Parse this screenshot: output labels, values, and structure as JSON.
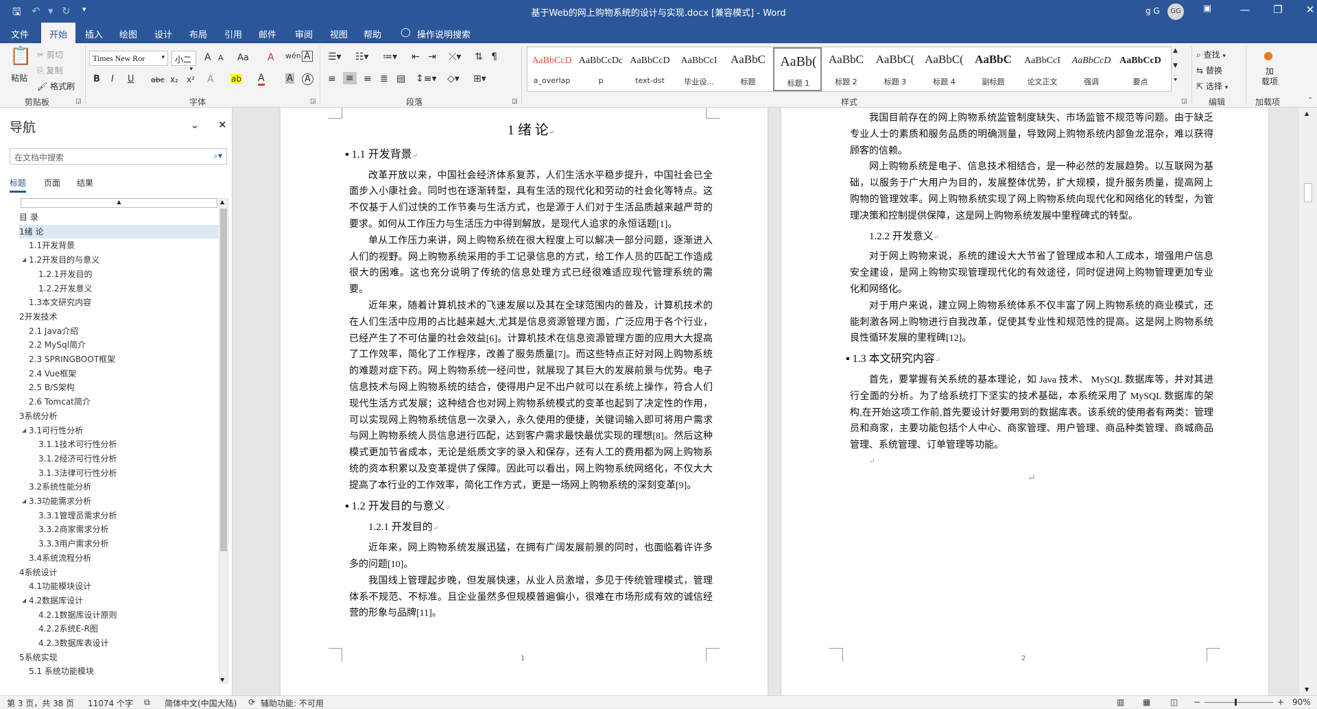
{
  "titlebar": {
    "save_icon": "save-icon",
    "undo_icon": "undo-icon",
    "redo_icon": "redo-icon",
    "customize_icon": "customize-icon",
    "title": "基于Web的网上购物系统的设计与实现.docx [兼容模式]  -  Word",
    "user": "g G",
    "avatar": "GG",
    "ribbon_display_icon": "ribbon-display-icon",
    "minimize": "—",
    "restore": "❐",
    "close": "✕"
  },
  "tabs": [
    "文件",
    "开始",
    "插入",
    "绘图",
    "设计",
    "布局",
    "引用",
    "邮件",
    "审阅",
    "视图",
    "帮助"
  ],
  "tellme": "操作说明搜索",
  "ribbon": {
    "clipboard": {
      "paste": "粘贴",
      "cut": "剪切",
      "copy": "复制",
      "painter": "格式刷",
      "label": "剪贴板"
    },
    "font": {
      "name": "Times New Ror",
      "size": "小二",
      "label": "字体",
      "grow": "A",
      "shrink": "A",
      "case": "Aa",
      "clear": "A",
      "bold": "B",
      "italic": "I",
      "underline": "U",
      "strike": "abc",
      "sub": "x₂",
      "sup": "x²",
      "effects": "A",
      "highlight": "ab",
      "color": "A",
      "shade": "A",
      "border": "A"
    },
    "paragraph": {
      "label": "段落"
    },
    "styles": {
      "label": "样式",
      "items": [
        {
          "sample": "AaBbCcD",
          "name": "a_overlap",
          "color": "#e05040"
        },
        {
          "sample": "AaBbCcDc",
          "name": "p",
          "color": "#222"
        },
        {
          "sample": "AaBbCcD",
          "name": "text-dst",
          "color": "#222"
        },
        {
          "sample": "AaBbCcI",
          "name": "毕业设...",
          "color": "#222"
        },
        {
          "sample": "AaBbC",
          "name": "标题",
          "color": "#222"
        },
        {
          "sample": "AaBb(",
          "name": "标题 1",
          "color": "#222"
        },
        {
          "sample": "AaBbC",
          "name": "标题 2",
          "color": "#222"
        },
        {
          "sample": "AaBbC(",
          "name": "标题 3",
          "color": "#222"
        },
        {
          "sample": "AaBbC(",
          "name": "标题 4",
          "color": "#222"
        },
        {
          "sample": "AaBbC",
          "name": "副标题",
          "color": "#222"
        },
        {
          "sample": "AaBbCcI",
          "name": "论文正文",
          "color": "#222"
        },
        {
          "sample": "AaBbCcD",
          "name": "强调",
          "color": "#222"
        },
        {
          "sample": "AaBbCcD",
          "name": "要点",
          "color": "#222"
        }
      ]
    },
    "editing": {
      "find": "查找",
      "replace": "替换",
      "select": "选择",
      "label": "编辑"
    },
    "addins": {
      "label": "加载项",
      "button": "加\n载项"
    }
  },
  "nav": {
    "title": "导航",
    "search_placeholder": "在文档中搜索",
    "tabs": [
      "标题",
      "页面",
      "结果"
    ],
    "items": [
      {
        "text": "目  录",
        "level": 0,
        "tri": ""
      },
      {
        "text": "1绪  论",
        "level": 0,
        "tri": "◢",
        "selected": true
      },
      {
        "text": "1.1开发背景",
        "level": 1,
        "tri": ""
      },
      {
        "text": "1.2开发目的与意义",
        "level": 1,
        "tri": "◢"
      },
      {
        "text": "1.2.1开发目的",
        "level": 2,
        "tri": ""
      },
      {
        "text": "1.2.2开发意义",
        "level": 2,
        "tri": ""
      },
      {
        "text": "1.3本文研究内容",
        "level": 1,
        "tri": ""
      },
      {
        "text": "2开发技术",
        "level": 0,
        "tri": "◢"
      },
      {
        "text": "2.1 Java介绍",
        "level": 1,
        "tri": ""
      },
      {
        "text": "2.2 MySql简介",
        "level": 1,
        "tri": ""
      },
      {
        "text": "2.3 SPRINGBOOT框架",
        "level": 1,
        "tri": ""
      },
      {
        "text": "2.4 Vue框架",
        "level": 1,
        "tri": ""
      },
      {
        "text": "2.5 B/S架构",
        "level": 1,
        "tri": ""
      },
      {
        "text": "2.6 Tomcat简介",
        "level": 1,
        "tri": ""
      },
      {
        "text": "3系统分析",
        "level": 0,
        "tri": "◢"
      },
      {
        "text": "3.1可行性分析",
        "level": 1,
        "tri": "◢"
      },
      {
        "text": "3.1.1技术可行性分析",
        "level": 2,
        "tri": ""
      },
      {
        "text": "3.1.2经济可行性分析",
        "level": 2,
        "tri": ""
      },
      {
        "text": "3.1.3法律可行性分析",
        "level": 2,
        "tri": ""
      },
      {
        "text": "3.2系统性能分析",
        "level": 1,
        "tri": ""
      },
      {
        "text": "3.3功能需求分析",
        "level": 1,
        "tri": "◢"
      },
      {
        "text": "3.3.1管理员需求分析",
        "level": 2,
        "tri": ""
      },
      {
        "text": "3.3.2商家需求分析",
        "level": 2,
        "tri": ""
      },
      {
        "text": "3.3.3用户需求分析",
        "level": 2,
        "tri": ""
      },
      {
        "text": "3.4系统流程分析",
        "level": 1,
        "tri": ""
      },
      {
        "text": "4系统设计",
        "level": 0,
        "tri": "◢"
      },
      {
        "text": "4.1功能模块设计",
        "level": 1,
        "tri": ""
      },
      {
        "text": "4.2数据库设计",
        "level": 1,
        "tri": "◢"
      },
      {
        "text": "4.2.1数据库设计原则",
        "level": 2,
        "tri": ""
      },
      {
        "text": "4.2.2系统E-R图",
        "level": 2,
        "tri": ""
      },
      {
        "text": "4.2.3数据库表设计",
        "level": 2,
        "tri": ""
      },
      {
        "text": "5系统实现",
        "level": 0,
        "tri": "◢"
      },
      {
        "text": "5.1  系统功能模块",
        "level": 1,
        "tri": ""
      }
    ]
  },
  "page1": {
    "h1": "1 绪  论",
    "h2_1": "1.1 开发背景",
    "p1": "改革开放以来，中国社会经济体系复苏，人们生活水平稳步提升，中国社会已全面步入小康社会。同时也在逐渐转型，具有生活的现代化和劳动的社会化等特点。这不仅基于人们过快的工作节奏与生活方式，也是源于人们对于生活品质越来越严苛的要求。如何从工作压力与生活压力中得到解放，是现代人追求的永恒话题[1]。",
    "p2": "单从工作压力来讲，网上购物系统在很大程度上可以解决一部分问题，逐渐进入人们的视野。网上购物系统采用的手工记录信息的方式，给工作人员的匹配工作造成很大的困难。这也充分说明了传统的信息处理方式已经很难适应现代管理系统的需要。",
    "p3": "近年来，随着计算机技术的飞速发展以及其在全球范围内的普及，计算机技术的在人们生活中应用的占比越来越大,尤其是信息资源管理方面，广泛应用于各个行业，已经产生了不可估量的社会效益[6]。计算机技术在信息资源管理方面的应用大大提高了工作效率，简化了工作程序，改善了服务质量[7]。而这些特点正好对网上购物系统的难题对症下药。网上购物系统一经问世，就展现了其巨大的发展前景与优势。电子信息技术与网上购物系统的结合，使得用户足不出户就可以在系统上操作，符合人们现代生活方式发展；这种结合也对网上购物系统模式的变革也起到了决定性的作用，可以实现网上购物系统信息一次录入，永久使用的便捷，关键词输入即可将用户需求与网上购物系统人员信息进行匹配，达到客户需求最快最优实现的理想[8]。然后这种模式更加节省成本，无论是纸质文字的录入和保存，还有人工的费用都为网上购物系统的资本积累以及变革提供了保障。因此可以看出，网上购物系统网络化，不仅大大提高了本行业的工作效率，简化工作方式，更是一场网上购物系统的深刻变革[9]。",
    "h2_2": "1.2 开发目的与意义",
    "h3_1": "1.2.1 开发目的",
    "p4": "近年来，网上购物系统发展迅猛，在拥有广阔发展前景的同时，也面临着许许多多的问题[10]。",
    "p5": "我国线上管理起步晚，但发展快速，从业人员激增，多见于传统管理模式，管理体系不规范、不标准。且企业虽然多但规模普遍偏小，很难在市场形成有效的诚信经营的形象与品牌[11]。",
    "pagenum": "1"
  },
  "page2": {
    "p1": "我国目前存在的网上购物系统监管制度缺失、市场监管不规范等问题。由于缺乏专业人士的素质和服务品质的明确测量，导致网上购物系统内部鱼龙混杂，难以获得顾客的信赖。",
    "p2": "网上购物系统是电子、信息技术相结合，是一种必然的发展趋势。以互联网为基础，以服务于广大用户为目的，发展整体优势，扩大规模，提升服务质量，提高网上购物的管理效率。网上购物系统实现了网上购物系统向现代化和网络化的转型，为管理决策和控制提供保障，这是网上购物系统发展中里程碑式的转型。",
    "h3_2": "1.2.2 开发意义",
    "p3": "对于网上购物来说，系统的建设大大节省了管理成本和人工成本，增强用户信息安全建设，是网上购物实现管理现代化的有效途径，同时促进网上购物管理更加专业化和网络化。",
    "p4": "对于用户来说，建立网上购物系统体系不仅丰富了网上购物系统的商业模式，还能刺激各网上购物进行自我改革，促使其专业性和规范性的提高。这是网上购物系统良性循环发展的里程碑[12]。",
    "h2_3": "1.3 本文研究内容",
    "p5": "首先，要掌握有关系统的基本理论，如 Java 技术、 MySQL 数据库等，并对其进行全面的分析。为了给系统打下坚实的技术基础，本系统采用了 MySQL 数据库的架构,在开始这项工作前,首先要设计好要用到的数据库表。该系统的使用者有两类：管理员和商家，主要功能包括个人中心、商家管理、用户管理、商品种类管理、商城商品管理、系统管理、订单管理等功能。",
    "pagenum": "2"
  },
  "status": {
    "page": "第 3 页，共 38 页",
    "words": "11074 个字",
    "lang": "简体中文(中国大陆)",
    "access": "辅助功能: 不可用",
    "zoom": "90%"
  }
}
